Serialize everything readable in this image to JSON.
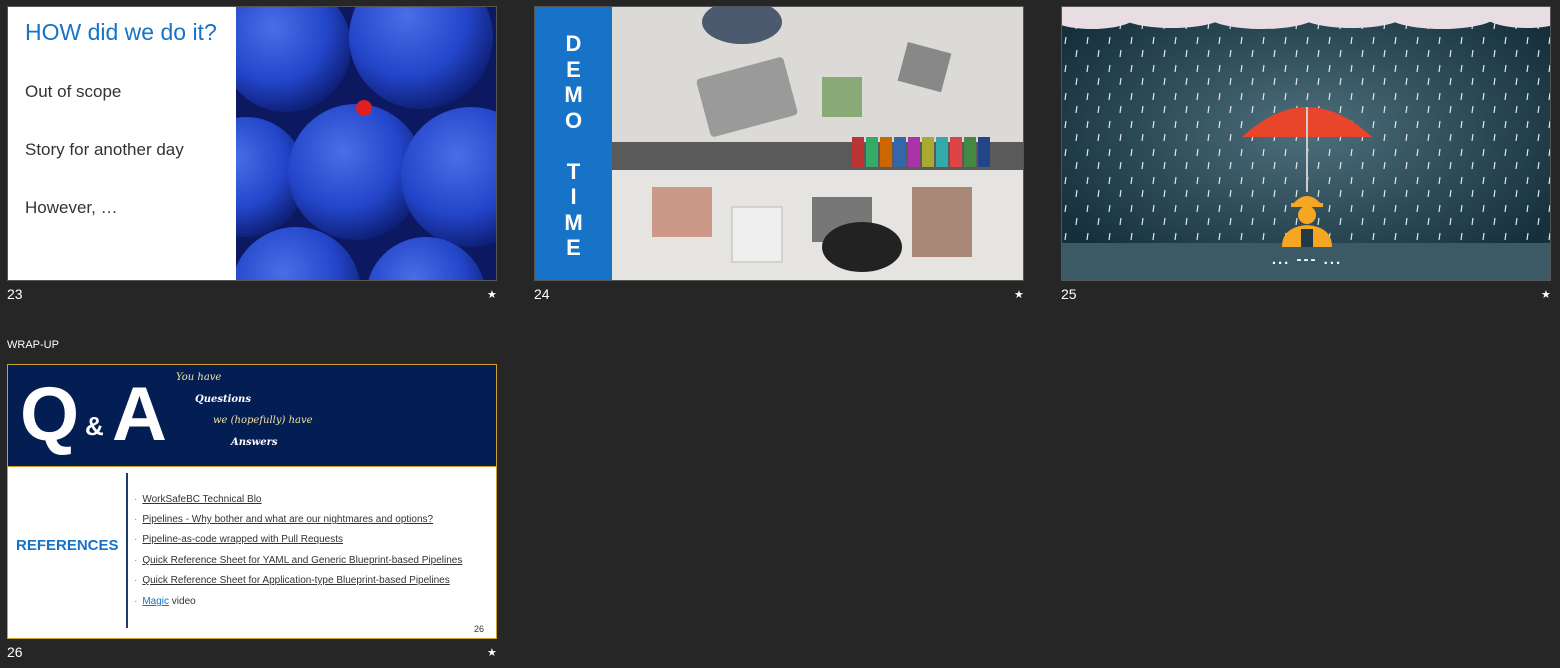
{
  "slides": [
    {
      "number": "23",
      "star": "★"
    },
    {
      "number": "24",
      "star": "★"
    },
    {
      "number": "25",
      "star": "★"
    },
    {
      "number": "26",
      "star": "★"
    }
  ],
  "section_label": "WRAP-UP",
  "slide23": {
    "title": "HOW did we do it?",
    "lines": [
      "Out of scope",
      "Story for another day",
      "However, …"
    ]
  },
  "slide24": {
    "band_text": "D\nE\nM\nO\n\nT\nI\nM\nE"
  },
  "slide25": {
    "caption": "... --- ..."
  },
  "slide26": {
    "q": "Q",
    "amp": "&",
    "a": "A",
    "header_lines": [
      "You have",
      "Questions",
      "we (hopefully) have",
      "Answers"
    ],
    "refs_title": "REFERENCES",
    "refs": [
      {
        "text": "WorkSafeBC Technical Blo",
        "suffix": ""
      },
      {
        "text": "Pipelines - Why bother and what are our nightmares and options?",
        "suffix": ""
      },
      {
        "text": "Pipeline-as-code wrapped with Pull Requests",
        "suffix": ""
      },
      {
        "text": "Quick Reference Sheet for YAML and Generic Blueprint-based Pipelines",
        "suffix": ""
      },
      {
        "text": "Quick Reference Sheet for Application-type Blueprint-based Pipelines",
        "suffix": ""
      },
      {
        "text": "Magic",
        "suffix": " video"
      }
    ],
    "page_number": "26"
  },
  "colors": {
    "accent": "#1673c7",
    "navy": "#031e52",
    "gold": "#c9a227",
    "background": "#262626"
  }
}
